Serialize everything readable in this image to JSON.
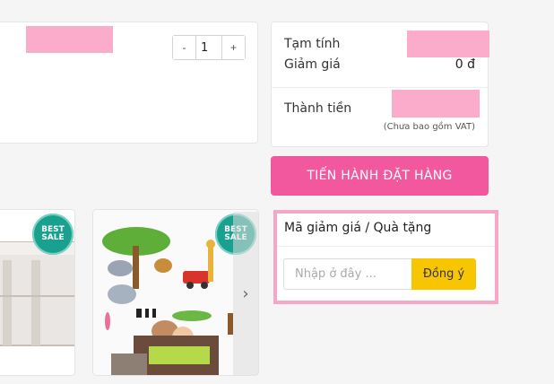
{
  "cart": {
    "qty": {
      "minus": "-",
      "value": "1",
      "plus": "+"
    }
  },
  "summary": {
    "subtotal_label": "Tạm tính",
    "discount_label": "Giảm giá",
    "discount_value": "0 đ",
    "total_label": "Thành tiền",
    "vat_note": "(Chưa bao gồm VAT)"
  },
  "checkout": {
    "label": "TIẾN HÀNH ĐẶT HÀNG"
  },
  "products": [
    {
      "badge_top": "BEST",
      "badge_bottom": "SALE"
    },
    {
      "badge_top": "BEST",
      "badge_bottom": "SALE"
    }
  ],
  "carousel": {
    "next_icon": "chevron-right-icon",
    "next_glyph": "›"
  },
  "promo": {
    "title": "Mã giảm giá / Quà tặng",
    "placeholder": "Nhập ở đây ...",
    "apply_label": "Đồng ý"
  },
  "colors": {
    "checkout_bg": "#f2589e",
    "apply_bg": "#f7c600",
    "promo_border": "#f6a6c7",
    "badge_bg": "#1aa08e",
    "redaction": "#fcaccb"
  }
}
